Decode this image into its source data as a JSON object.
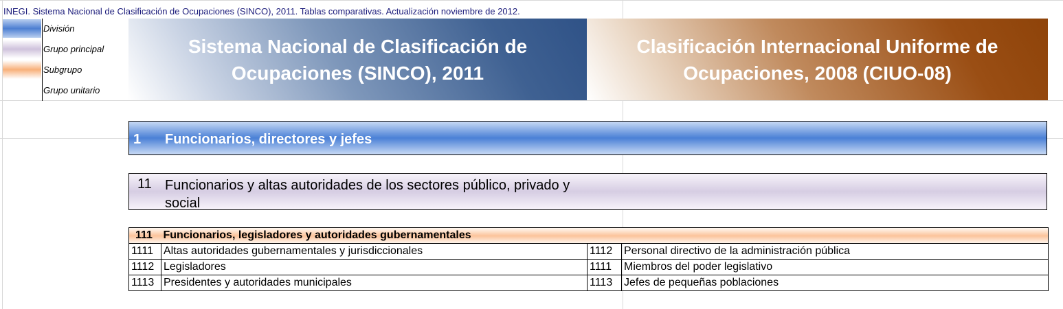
{
  "source_line": "INEGI. Sistema Nacional de Clasificación de Ocupaciones (SINCO), 2011. Tablas comparativas. Actualización noviembre de 2012.",
  "legend": {
    "items": [
      {
        "label": "División",
        "color": "#4d7fd2"
      },
      {
        "label": "Grupo principal",
        "color": "#cfc2dc"
      },
      {
        "label": "Subgrupo",
        "color": "#f8b07a"
      },
      {
        "label": "Grupo unitario",
        "color": "#ffffff"
      }
    ]
  },
  "headers": {
    "sinco": "Sistema Nacional de Clasificación de Ocupaciones (SINCO), 2011",
    "sinco_color": "#3f6192",
    "ciuo": "Clasificación Internacional Uniforme de Ocupaciones, 2008 (CIUO-08)",
    "ciuo_color": "#9a4e14"
  },
  "division": {
    "code": "1",
    "name": "Funcionarios, directores y jefes"
  },
  "grupo_principal": {
    "code": "11",
    "name": "Funcionarios y altas autoridades de los sectores público, privado y social"
  },
  "subgrupo": {
    "code": "111",
    "name": "Funcionarios, legisladores y autoridades gubernamentales"
  },
  "rows": [
    {
      "sinco_code": "1111",
      "sinco_name": "Altas autoridades gubernamentales y jurisdiccionales",
      "ciuo_code": "1112",
      "ciuo_name": "Personal directivo de la administración pública"
    },
    {
      "sinco_code": "1112",
      "sinco_name": "Legisladores",
      "ciuo_code": "1111",
      "ciuo_name": "Miembros del poder legislativo"
    },
    {
      "sinco_code": "1113",
      "sinco_name": "Presidentes y autoridades municipales",
      "ciuo_code": "1113",
      "ciuo_name": "Jefes de pequeñas poblaciones"
    }
  ]
}
